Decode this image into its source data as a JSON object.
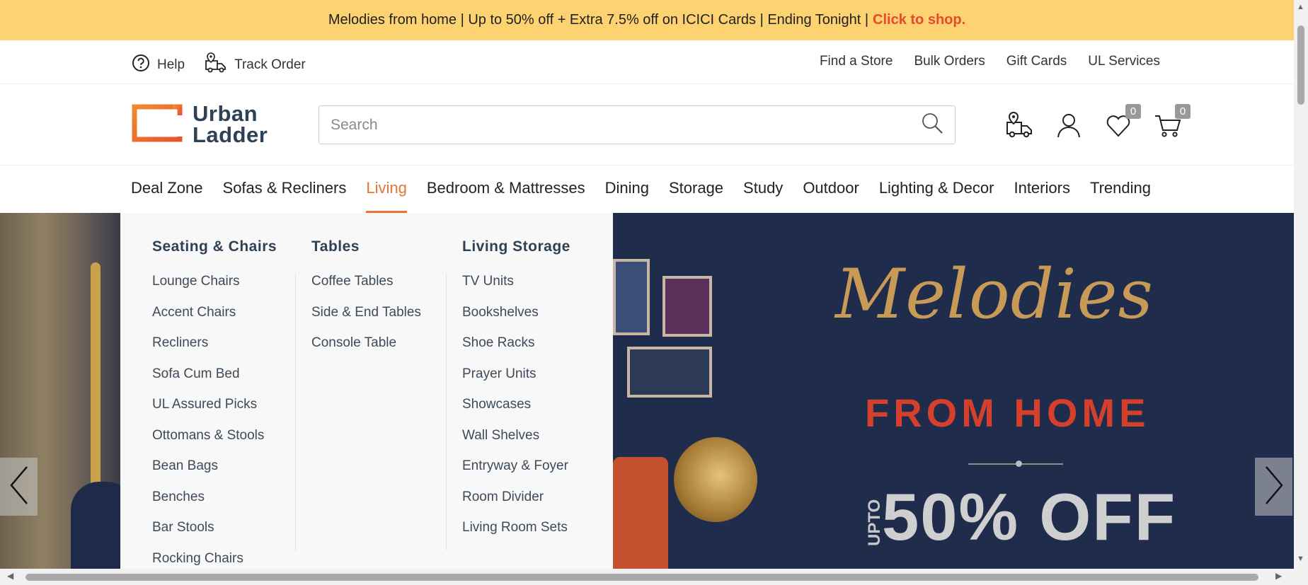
{
  "promo": {
    "text": "Melodies from home | Up to 50% off + Extra 7.5% off on ICICI Cards | Ending Tonight |",
    "cta": "Click to shop.",
    "accent_color": "#fdd270",
    "cta_color": "#e9472f"
  },
  "utility": {
    "help": "Help",
    "track_order": "Track Order",
    "find_store": "Find a Store",
    "bulk_orders": "Bulk Orders",
    "gift_cards": "Gift Cards",
    "ul_services": "UL Services"
  },
  "header": {
    "logo_line1": "Urban",
    "logo_line2": "Ladder",
    "search_placeholder": "Search",
    "wishlist_count": "0",
    "cart_count": "0"
  },
  "nav": {
    "items": [
      "Deal Zone",
      "Sofas & Recliners",
      "Living",
      "Bedroom & Mattresses",
      "Dining",
      "Storage",
      "Study",
      "Outdoor",
      "Lighting & Decor",
      "Interiors",
      "Trending"
    ],
    "active": "Living",
    "active_color": "#e8742d"
  },
  "mega_menu": {
    "columns": [
      {
        "heading": "Seating & Chairs",
        "items": [
          "Lounge Chairs",
          "Accent Chairs",
          "Recliners",
          "Sofa Cum Bed",
          "UL Assured Picks",
          "Ottomans & Stools",
          "Bean Bags",
          "Benches",
          "Bar Stools",
          "Rocking Chairs"
        ]
      },
      {
        "heading": "Tables",
        "items": [
          "Coffee Tables",
          "Side & End Tables",
          "Console Table"
        ]
      },
      {
        "heading": "Living Storage",
        "items": [
          "TV Units",
          "Bookshelves",
          "Shoe Racks",
          "Prayer Units",
          "Showcases",
          "Wall Shelves",
          "Entryway & Foyer",
          "Room Divider",
          "Living Room Sets"
        ]
      }
    ]
  },
  "hero": {
    "title": "Melodies",
    "subtitle": "FROM HOME",
    "upto": "UPTO",
    "offer": "50% OFF"
  }
}
